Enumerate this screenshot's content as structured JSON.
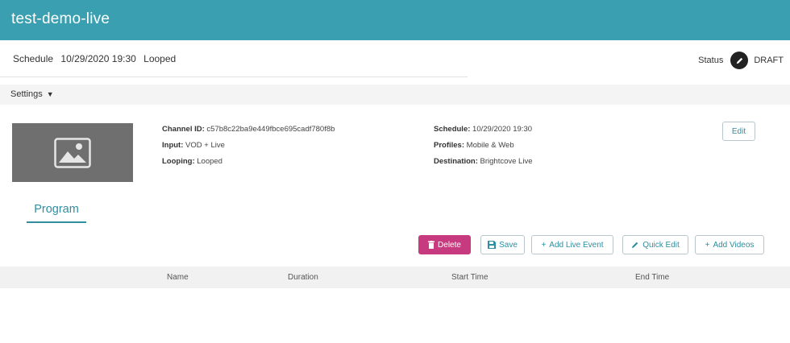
{
  "header": {
    "title": "test-demo-live"
  },
  "schedule_bar": {
    "label": "Schedule",
    "datetime": "10/29/2020 19:30",
    "mode": "Looped",
    "status_label": "Status",
    "status_value": "DRAFT"
  },
  "settings": {
    "label": "Settings"
  },
  "channel": {
    "channel_id_label": "Channel ID:",
    "channel_id": "c57b8c22ba9e449fbce695cadf780f8b",
    "input_label": "Input:",
    "input": "VOD + Live",
    "looping_label": "Looping:",
    "looping": "Looped",
    "schedule_label": "Schedule:",
    "schedule": "10/29/2020 19:30",
    "profiles_label": "Profiles:",
    "profiles": "Mobile & Web",
    "destination_label": "Destination:",
    "destination": "Brightcove Live",
    "edit_label": "Edit"
  },
  "tabs": {
    "program": "Program"
  },
  "toolbar": {
    "delete": "Delete",
    "save": "Save",
    "add_live_event": "Add Live Event",
    "quick_edit": "Quick Edit",
    "add_videos": "Add Videos"
  },
  "table": {
    "columns": [
      "Name",
      "Duration",
      "Start Time",
      "End Time"
    ]
  },
  "colors": {
    "header_bg": "#3a9fb0",
    "accent": "#2f8ea0",
    "delete_bg": "#c83a7f"
  }
}
